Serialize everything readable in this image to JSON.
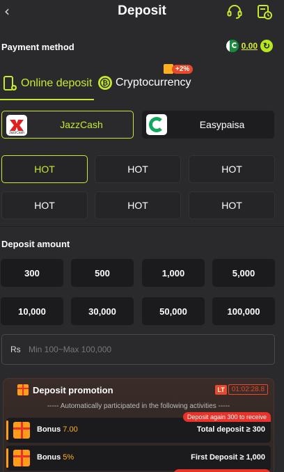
{
  "header": {
    "title": "Deposit"
  },
  "payment": {
    "label": "Payment method",
    "balance": "0.00"
  },
  "tabs": {
    "online": "Online deposit",
    "crypto": "Cryptocurrency",
    "crypto_bonus": "+2%"
  },
  "methods": [
    "JazzCash",
    "Easypaisa"
  ],
  "jazz_logo_text": "JazzCash",
  "channels": [
    "HOT",
    "HOT",
    "HOT",
    "HOT",
    "HOT",
    "HOT"
  ],
  "deposit": {
    "label": "Deposit amount",
    "amounts": [
      "300",
      "500",
      "1,000",
      "5,000",
      "10,000",
      "30,000",
      "50,000",
      "100,000"
    ],
    "currency": "Rs",
    "placeholder": "Min 100~Max 100,000"
  },
  "promotion": {
    "title": "Deposit promotion",
    "timer_tag": "LT",
    "timer": "01:02:28.8",
    "subtitle": "----- Automatically participated in the following activities -----",
    "rows": [
      {
        "label": "Bonus",
        "value": "7.00",
        "condition": "Total deposit ≥ 300",
        "tag": "Deposit again 300 to receive"
      },
      {
        "label": "Bonus",
        "value": "5%",
        "condition": "First Deposit ≥ 1,000"
      }
    ]
  },
  "colors": {
    "accent": "#c6ea32",
    "background": "#2a2a2d",
    "danger": "#e8492a",
    "bonus": "#ffb020"
  }
}
